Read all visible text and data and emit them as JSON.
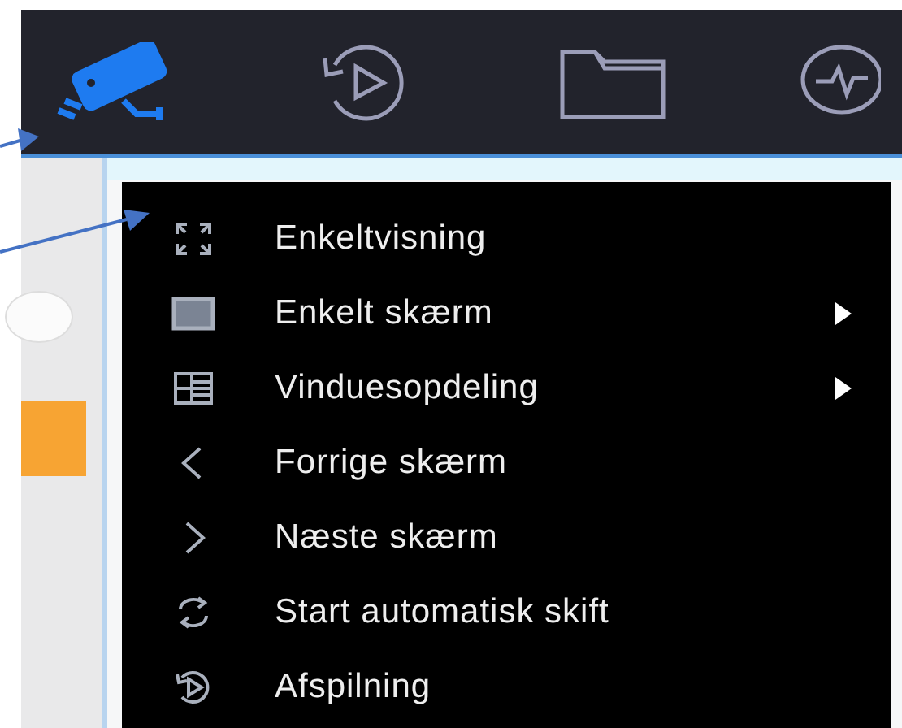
{
  "toolbar": {
    "items": [
      {
        "kind": "camera",
        "selected": true
      },
      {
        "kind": "playback",
        "selected": false
      },
      {
        "kind": "folder",
        "selected": false
      },
      {
        "kind": "search",
        "selected": false
      }
    ]
  },
  "context_menu": {
    "items": [
      {
        "kind": "fullscreen",
        "label": "Enkeltvisning",
        "submenu": false
      },
      {
        "kind": "screen",
        "label": "Enkelt skærm",
        "submenu": true
      },
      {
        "kind": "grid",
        "label": "Vinduesopdeling",
        "submenu": true
      },
      {
        "kind": "prev",
        "label": "Forrige skærm",
        "submenu": false
      },
      {
        "kind": "next",
        "label": "Næste skærm",
        "submenu": false
      },
      {
        "kind": "cycle",
        "label": "Start automatisk skift",
        "submenu": false
      },
      {
        "kind": "playback",
        "label": "Afspilning",
        "submenu": false
      }
    ]
  }
}
